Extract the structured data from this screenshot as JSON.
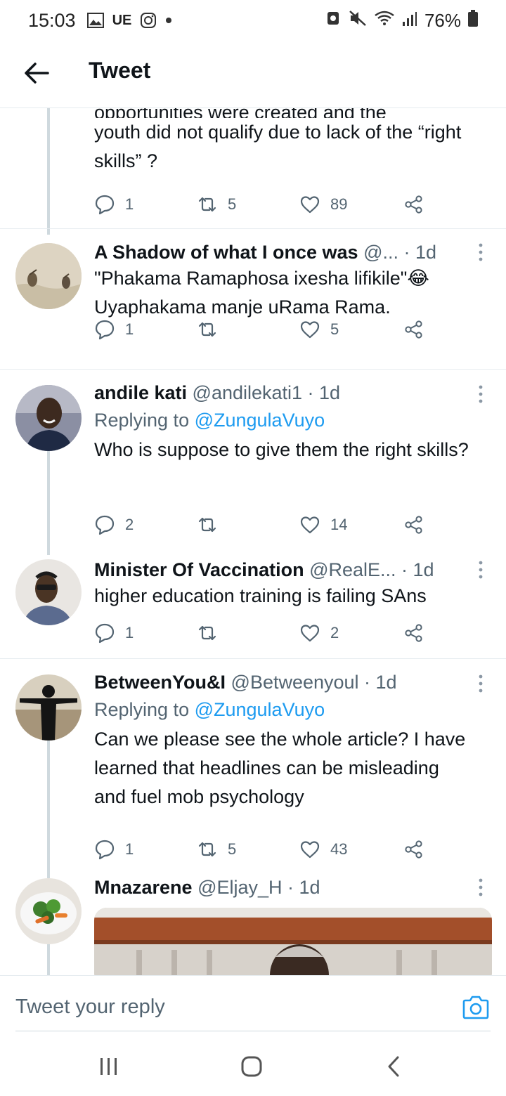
{
  "status_bar": {
    "time": "15:03",
    "left_icons": [
      "image-icon",
      "ue-badge",
      "instagram-icon",
      "dot"
    ],
    "ue_label": "UE",
    "battery": "76%"
  },
  "header": {
    "title": "Tweet"
  },
  "partial_tweet": {
    "text_cut": "opportunities were created and the",
    "text": "youth did not qualify due to lack of the “right skills” ?",
    "replies": "1",
    "retweets": "5",
    "likes": "89"
  },
  "tweets": [
    {
      "name": "A Shadow of what I once was",
      "meta": " @... · 1d",
      "text_line1": "\"Phakama Ramaphosa ixesha lifikile\"😂",
      "text_line2": "Uyaphakama manje uRama Rama.",
      "replies": "1",
      "retweets": "",
      "likes": "5"
    },
    {
      "name": "andile kati",
      "meta": " @andilekati1 · 1d",
      "replying_prefix": "Replying to ",
      "replying_to": "@ZungulaVuyo",
      "text": "Who is suppose to give them the right skills?",
      "replies": "2",
      "retweets": "",
      "likes": "14"
    },
    {
      "name": "Minister Of Vaccination",
      "meta": " @RealE... · 1d",
      "text": "higher education training is failing SAns",
      "replies": "1",
      "retweets": "",
      "likes": "2"
    },
    {
      "name": "BetweenYou&I",
      "meta": " @Betweenyoul · 1d",
      "replying_prefix": "Replying to ",
      "replying_to": "@ZungulaVuyo",
      "text": "Can we please see the whole article? I have learned that headlines can be misleading and fuel mob psychology",
      "replies": "1",
      "retweets": "5",
      "likes": "43"
    },
    {
      "name": "Mnazarene",
      "meta": " @Eljay_H · 1d"
    }
  ],
  "reply_bar": {
    "placeholder": "Tweet your reply"
  },
  "colors": {
    "link": "#1d9bf0",
    "secondary": "#536471",
    "primary_text": "#0f1419",
    "divider": "#e6ecf0"
  }
}
